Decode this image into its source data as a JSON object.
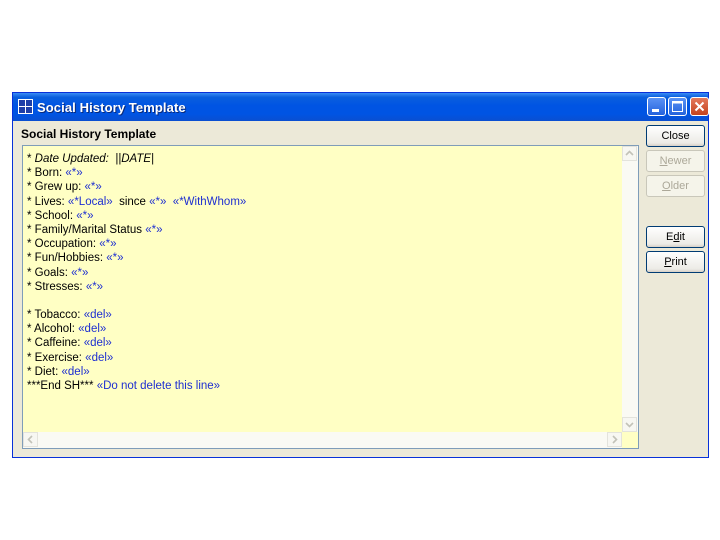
{
  "window": {
    "title": "Social History Template",
    "header": "Social History Template"
  },
  "buttons": [
    {
      "pre": "Close",
      "u": "",
      "post": "",
      "enabled": true
    },
    {
      "pre": "",
      "u": "N",
      "post": "ewer",
      "enabled": false
    },
    {
      "pre": "",
      "u": "O",
      "post": "lder",
      "enabled": false
    },
    {
      "pre": "E",
      "u": "d",
      "post": "it",
      "enabled": true
    },
    {
      "pre": "",
      "u": "P",
      "post": "rint",
      "enabled": true
    }
  ],
  "lines": [
    [
      {
        "t": "* "
      },
      {
        "t": "Date Updated:  ||DATE|",
        "i": true
      }
    ],
    [
      {
        "t": "* Born: "
      },
      {
        "t": "«*»",
        "v": true
      }
    ],
    [
      {
        "t": "* Grew up: "
      },
      {
        "t": "«*»",
        "v": true
      }
    ],
    [
      {
        "t": "* Lives: "
      },
      {
        "t": "«*Local»",
        "v": true
      },
      {
        "t": "  since "
      },
      {
        "t": "«*»",
        "v": true
      },
      {
        "t": "  "
      },
      {
        "t": "«*WithWhom»",
        "v": true
      }
    ],
    [
      {
        "t": "* School: "
      },
      {
        "t": "«*»",
        "v": true
      }
    ],
    [
      {
        "t": "* Family/Marital Status "
      },
      {
        "t": "«*»",
        "v": true
      }
    ],
    [
      {
        "t": "* Occupation: "
      },
      {
        "t": "«*»",
        "v": true
      }
    ],
    [
      {
        "t": "* Fun/Hobbies: "
      },
      {
        "t": "«*»",
        "v": true
      }
    ],
    [
      {
        "t": "* Goals: "
      },
      {
        "t": "«*»",
        "v": true
      }
    ],
    [
      {
        "t": "* Stresses: "
      },
      {
        "t": "«*»",
        "v": true
      }
    ],
    [],
    [
      {
        "t": "* Tobacco: "
      },
      {
        "t": "«del»",
        "v": true
      }
    ],
    [
      {
        "t": "* Alcohol: "
      },
      {
        "t": "«del»",
        "v": true
      }
    ],
    [
      {
        "t": "* Caffeine: "
      },
      {
        "t": "«del»",
        "v": true
      }
    ],
    [
      {
        "t": "* Exercise: "
      },
      {
        "t": "«del»",
        "v": true
      }
    ],
    [
      {
        "t": "* Diet: "
      },
      {
        "t": "«del»",
        "v": true
      }
    ],
    [
      {
        "t": "***End SH*** "
      },
      {
        "t": "«Do not delete this line»",
        "v": true
      }
    ]
  ]
}
